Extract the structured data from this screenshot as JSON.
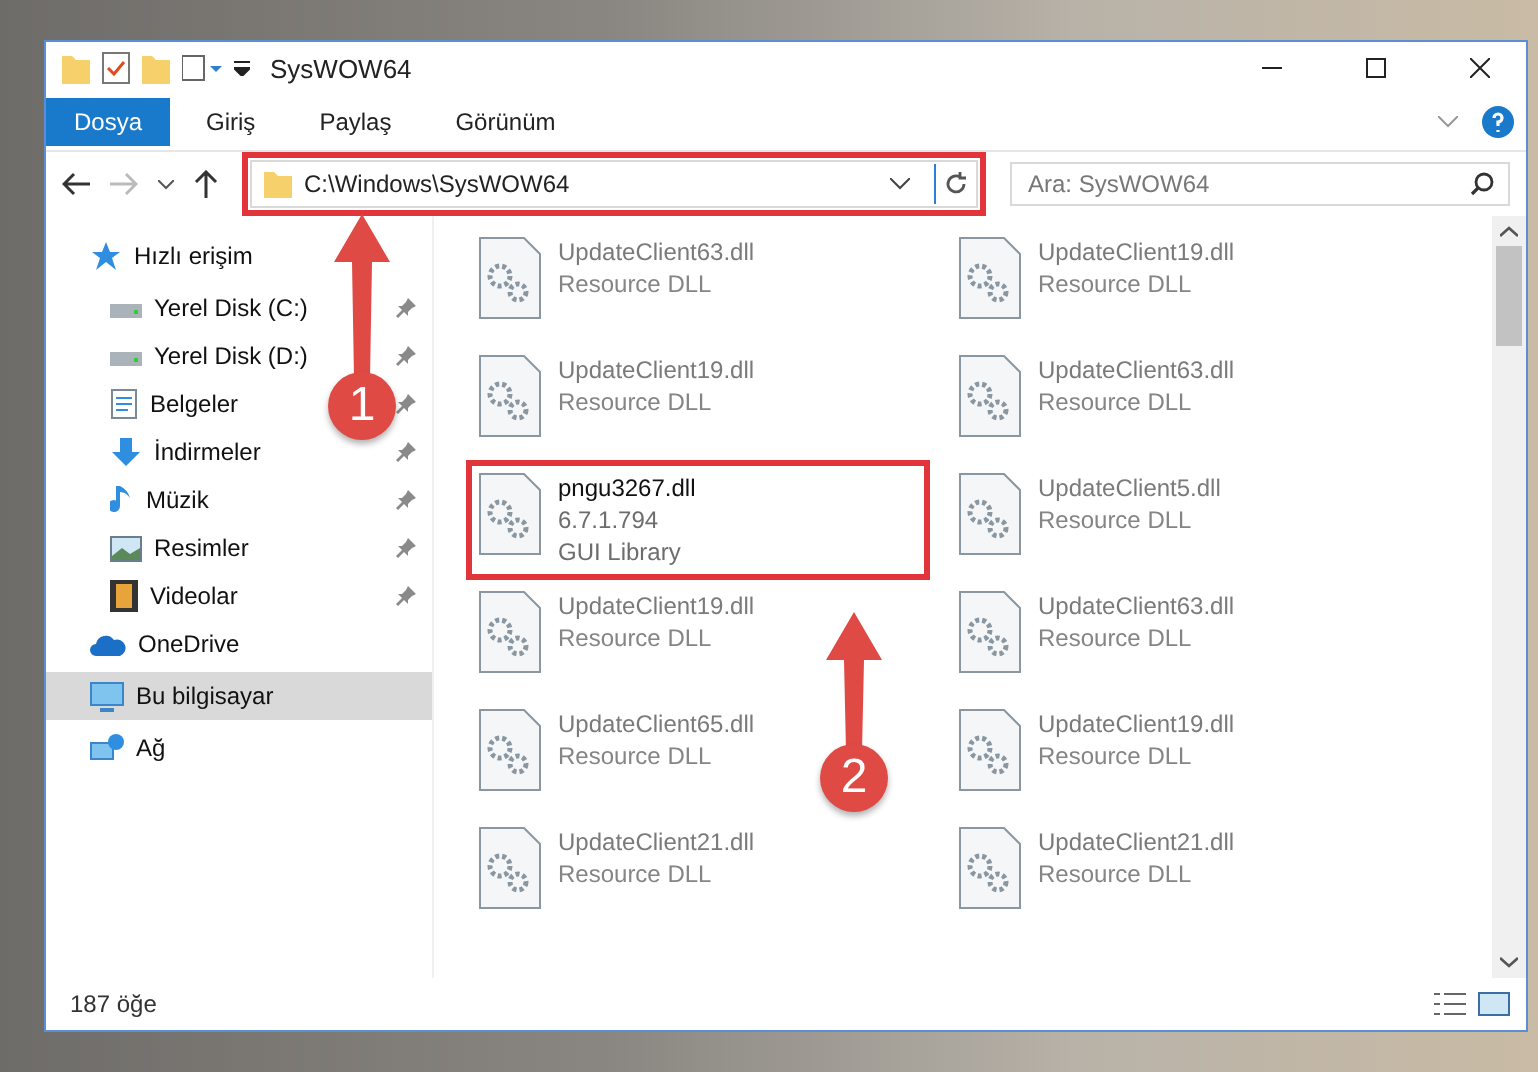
{
  "window": {
    "title": "SysWOW64"
  },
  "ribbon_tabs": [
    {
      "label": "Dosya",
      "selected": true
    },
    {
      "label": "Giriş",
      "selected": false
    },
    {
      "label": "Paylaş",
      "selected": false
    },
    {
      "label": "Görünüm",
      "selected": false
    }
  ],
  "address": {
    "path": "C:\\Windows\\SysWOW64",
    "highlighted": true
  },
  "search": {
    "placeholder": "Ara: SysWOW64"
  },
  "nav": [
    {
      "label": "Hızlı erişim",
      "kind": "star",
      "selected": false,
      "children": [
        {
          "label": "Yerel Disk (C:)",
          "kind": "drive",
          "pinned": true,
          "selected": false
        },
        {
          "label": "Yerel Disk (D:)",
          "kind": "drive",
          "pinned": true,
          "selected": false
        },
        {
          "label": "Belgeler",
          "kind": "doc",
          "pinned": true,
          "selected": false
        },
        {
          "label": "İndirmeler",
          "kind": "download",
          "pinned": true,
          "selected": false
        },
        {
          "label": "Müzik",
          "kind": "music",
          "pinned": true,
          "selected": false
        },
        {
          "label": "Resimler",
          "kind": "picture",
          "pinned": true,
          "selected": false
        },
        {
          "label": "Videolar",
          "kind": "video",
          "pinned": true,
          "selected": false
        }
      ]
    },
    {
      "label": "OneDrive",
      "kind": "cloud",
      "selected": false
    },
    {
      "label": "Bu bilgisayar",
      "kind": "pc",
      "selected": true
    },
    {
      "label": "Ağ",
      "kind": "network",
      "selected": false
    }
  ],
  "files": [
    {
      "name": "UpdateClient63.dll",
      "type": "Resource DLL",
      "blurred": true
    },
    {
      "name": "UpdateClient19.dll",
      "type": "Resource DLL",
      "blurred": true
    },
    {
      "name": "UpdateClient19.dll",
      "type": "Resource DLL",
      "blurred": true
    },
    {
      "name": "UpdateClient63.dll",
      "type": "Resource DLL",
      "blurred": true
    },
    {
      "name": "pngu3267.dll",
      "version": "6.7.1.794",
      "type": "GUI Library",
      "blurred": false,
      "highlighted": true
    },
    {
      "name": "UpdateClient5.dll",
      "type": "Resource DLL",
      "blurred": true
    },
    {
      "name": "UpdateClient19.dll",
      "type": "Resource DLL",
      "blurred": true
    },
    {
      "name": "UpdateClient63.dll",
      "type": "Resource DLL",
      "blurred": true
    },
    {
      "name": "UpdateClient65.dll",
      "type": "Resource DLL",
      "blurred": true
    },
    {
      "name": "UpdateClient19.dll",
      "type": "Resource DLL",
      "blurred": true
    },
    {
      "name": "UpdateClient21.dll",
      "type": "Resource DLL",
      "blurred": true
    },
    {
      "name": "UpdateClient21.dll",
      "type": "Resource DLL",
      "blurred": true
    }
  ],
  "status_bar": {
    "count": "187 öğe"
  },
  "annotations": [
    {
      "number": "1"
    },
    {
      "number": "2"
    }
  ]
}
